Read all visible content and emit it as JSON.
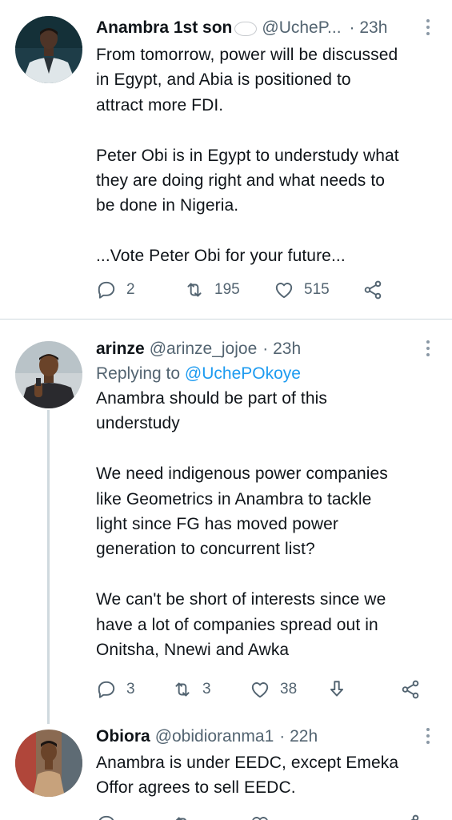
{
  "tweets": [
    {
      "name": "Anambra 1st son",
      "handle": "@UcheP...",
      "time": "· 23h",
      "reply_prefix": "",
      "reply_mention": "",
      "text": "From tomorrow, power will be discussed\nin Egypt, and Abia is positioned to\nattract more FDI.\n\nPeter Obi is in Egypt to understudy what\nthey are doing right and what needs to\nbe done in Nigeria.\n\n...Vote Peter Obi for your future...",
      "replies": "2",
      "retweets": "195",
      "likes": "515"
    },
    {
      "name": "arinze",
      "handle": "@arinze_jojoe",
      "time": "· 23h",
      "reply_prefix": "Replying to ",
      "reply_mention": "@UchePOkoye",
      "text": "Anambra should be part of this\nunderstudy\n\nWe need indigenous power companies\nlike Geometrics in Anambra to tackle\nlight since FG has moved power\ngeneration to concurrent list?\n\nWe can't be short of interests since we\nhave a lot of companies spread out in\nOnitsha, Nnewi and Awka",
      "replies": "3",
      "retweets": "3",
      "likes": "38"
    },
    {
      "name": "Obiora",
      "handle": "@obidioranma1",
      "time": "· 22h",
      "reply_prefix": "",
      "reply_mention": "",
      "text": "Anambra is under EEDC, except Emeka\nOffor agrees to sell EEDC.",
      "replies": "",
      "retweets": "",
      "likes": ""
    }
  ],
  "colors": {
    "text_primary": "#0f1419",
    "text_secondary": "#536471",
    "link": "#1d9bf0",
    "divider": "#cfd9de"
  },
  "icons": [
    "reply-icon",
    "retweet-icon",
    "like-icon",
    "share-icon",
    "tip-icon",
    "more-options-icon",
    "thought-bubble-icon"
  ]
}
